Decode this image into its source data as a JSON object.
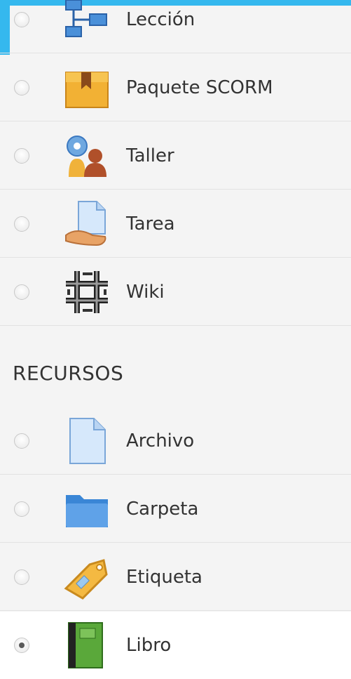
{
  "activities": [
    {
      "label": "Lección",
      "icon": "lesson-icon",
      "selected": false
    },
    {
      "label": "Paquete SCORM",
      "icon": "scorm-package-icon",
      "selected": false
    },
    {
      "label": "Taller",
      "icon": "workshop-icon",
      "selected": false
    },
    {
      "label": "Tarea",
      "icon": "assignment-icon",
      "selected": false
    },
    {
      "label": "Wiki",
      "icon": "wiki-icon",
      "selected": false
    }
  ],
  "resources_heading": "RECURSOS",
  "resources": [
    {
      "label": "Archivo",
      "icon": "file-icon",
      "selected": false
    },
    {
      "label": "Carpeta",
      "icon": "folder-icon",
      "selected": false
    },
    {
      "label": "Etiqueta",
      "icon": "label-tag-icon",
      "selected": false
    },
    {
      "label": "Libro",
      "icon": "book-icon",
      "selected": true
    }
  ],
  "colors": {
    "accent": "#35b8ee",
    "background": "#f4f4f4",
    "selected_row": "#ffffff"
  }
}
